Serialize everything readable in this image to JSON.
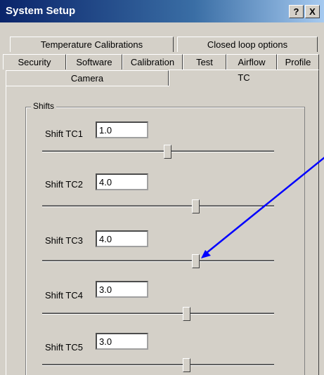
{
  "window": {
    "title": "System Setup"
  },
  "title_buttons": {
    "help": "?",
    "close": "X"
  },
  "tabs": {
    "row1": [
      "Temperature Calibrations",
      "Closed loop options"
    ],
    "row2": [
      "Security",
      "Software",
      "Calibration",
      "Test",
      "Airflow",
      "Profile"
    ],
    "row3": [
      "Camera",
      "TC"
    ],
    "active": "TC"
  },
  "group": {
    "label": "Shifts"
  },
  "shifts": [
    {
      "label": "Shift TC1",
      "value": "1.0",
      "slider_fraction": 0.54
    },
    {
      "label": "Shift TC2",
      "value": "4.0",
      "slider_fraction": 0.66
    },
    {
      "label": "Shift TC3",
      "value": "4.0",
      "slider_fraction": 0.66
    },
    {
      "label": "Shift TC4",
      "value": "3.0",
      "slider_fraction": 0.62
    },
    {
      "label": "Shift TC5",
      "value": "3.0",
      "slider_fraction": 0.62
    }
  ],
  "colors": {
    "annotation_arrow": "#0000ff",
    "face": "#d4d0c8",
    "titlebar": "#0a246a"
  }
}
